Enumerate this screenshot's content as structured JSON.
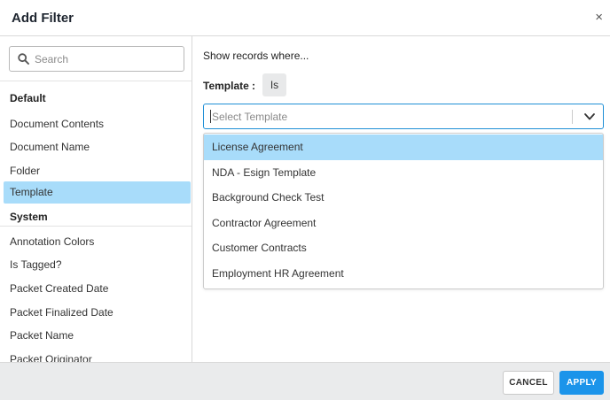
{
  "dialog": {
    "title": "Add Filter",
    "close_glyph": "×"
  },
  "sidebar": {
    "search": {
      "placeholder": "Search",
      "value": ""
    },
    "groups": [
      {
        "title": "Default",
        "items": [
          {
            "label": "Document Contents"
          },
          {
            "label": "Document Name"
          },
          {
            "label": "Folder"
          },
          {
            "label": "Template",
            "selected": true
          }
        ]
      },
      {
        "title": "System",
        "items": [
          {
            "label": "Annotation Colors"
          },
          {
            "label": "Is Tagged?"
          },
          {
            "label": "Packet Created Date"
          },
          {
            "label": "Packet Finalized Date"
          },
          {
            "label": "Packet Name"
          },
          {
            "label": "Packet Originator"
          }
        ]
      }
    ]
  },
  "main": {
    "show_text": "Show records where...",
    "field_label": "Template",
    "colon": ":",
    "operator": "Is",
    "select": {
      "placeholder": "Select Template",
      "value": ""
    },
    "options": [
      {
        "label": "License Agreement",
        "highlighted": true
      },
      {
        "label": "NDA - Esign Template"
      },
      {
        "label": "Background Check Test"
      },
      {
        "label": "Contractor Agreement"
      },
      {
        "label": "Customer Contracts"
      },
      {
        "label": "Employment HR Agreement"
      }
    ]
  },
  "footer": {
    "cancel_label": "CANCEL",
    "apply_label": "APPLY"
  },
  "colors": {
    "accent": "#1b94ea",
    "selection": "#a8dcfa",
    "focus_border": "#1f8fd6"
  },
  "icons": {
    "search": "search-icon",
    "close": "close-icon",
    "dropdown": "chevron-down-icon"
  }
}
